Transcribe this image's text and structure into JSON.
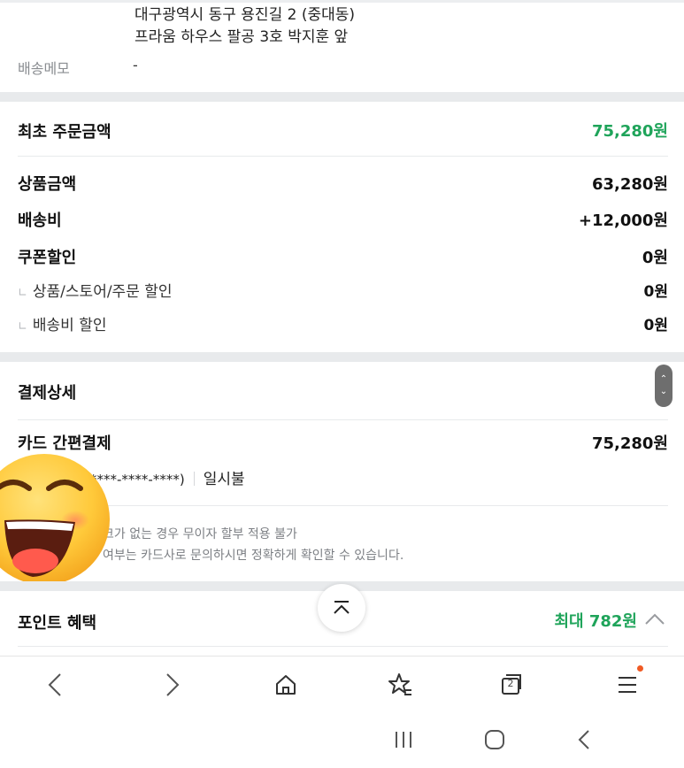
{
  "shipping": {
    "address_line1": "대구광역시 동구 용진길 2 (중대동)",
    "address_line2": "프라움 하우스 팔공 3호 박지훈 앞",
    "memo_label": "배송메모",
    "memo_value": "-"
  },
  "order_summary": {
    "title": "최초 주문금액",
    "total": "75,280원",
    "rows": [
      {
        "label": "상품금액",
        "value": "63,280원"
      },
      {
        "label": "배송비",
        "value": "+12,000원"
      },
      {
        "label": "쿠폰할인",
        "value": "0원"
      }
    ],
    "sub_rows": [
      {
        "label": "상품/스토어/주문 할인",
        "value": "0원"
      },
      {
        "label": "배송비 할인",
        "value": "0원"
      }
    ]
  },
  "payment": {
    "title": "결제상세",
    "method": "카드 간편결제",
    "amount": "75,280원",
    "card_masked": "****-****-****)",
    "installment": "일시불",
    "notice_1": "크가 없는 경우 무이자 할부 적용 불가",
    "notice_2": "여부는 카드사로 문의하시면 정확하게 확인할 수 있습니다."
  },
  "points": {
    "title": "포인트 혜택",
    "value": "최대 782원"
  },
  "browser_nav": {
    "tab_count": "2",
    "icons": [
      "back-arrow-icon",
      "forward-arrow-icon",
      "home-icon",
      "bookmark-star-icon",
      "tabs-icon",
      "menu-icon"
    ]
  },
  "system_nav": {
    "icons": [
      "recent-apps-icon",
      "home-circle-icon",
      "system-back-icon"
    ]
  },
  "colors": {
    "accent_green": "#1fa45a",
    "notification_dot": "#f05a24",
    "section_gap": "#e8eaec"
  }
}
